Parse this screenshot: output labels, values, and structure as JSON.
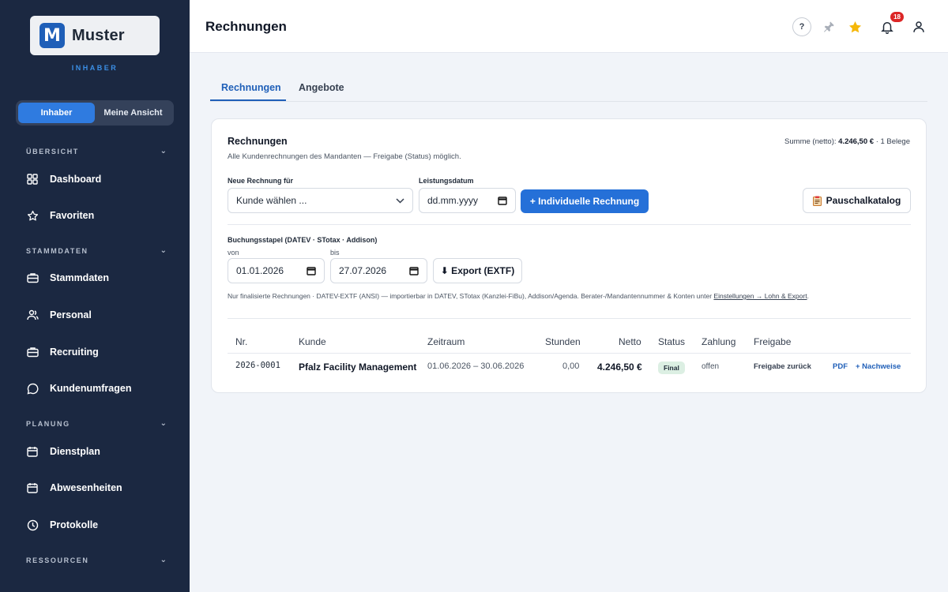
{
  "sidebar": {
    "brand": "Muster",
    "brand_mark": "M",
    "role_label": "INHABER",
    "toggle": [
      "Inhaber",
      "Meine Ansicht"
    ],
    "sections": {
      "overview": "ÜBERSICHT",
      "masterdata": "STAMMDATEN",
      "planning": "PLANUNG",
      "resources": "RESSOURCEN"
    },
    "items": {
      "dashboard": "Dashboard",
      "favorites": "Favoriten",
      "masterdata": "Stammdaten",
      "staff": "Personal",
      "recruiting": "Recruiting",
      "surveys": "Kundenumfragen",
      "roster": "Dienstplan",
      "absences": "Abwesenheiten",
      "logs": "Protokolle"
    }
  },
  "header": {
    "title": "Rechnungen",
    "help": "?",
    "notifications_count": "18"
  },
  "tabs": [
    "Rechnungen",
    "Angebote"
  ],
  "card": {
    "title": "Rechnungen",
    "subtitle": "Alle Kundenrechnungen des Mandanten — Freigabe (Status) möglich.",
    "summary_label": "Summe (netto):",
    "summary_value": "4.246,50 €",
    "summary_count": "· 1 Belege",
    "new_invoice_label": "Neue Rechnung für",
    "customer_placeholder": "Kunde wählen ...",
    "service_date_label": "Leistungsdatum",
    "service_date_placeholder": "dd.mm.yyyy",
    "individual_button": "+ Individuelle Rechnung",
    "catalog_button": "Pauschalkatalog",
    "batch_label": "Buchungsstapel (DATEV · STotax · Addison)",
    "from_label": "von",
    "to_label": "bis",
    "from_value": "01.01.2026",
    "to_value": "27.07.2026",
    "export_button": "⬇ Export (EXTF)",
    "note_text": "Nur finalisierte Rechnungen · DATEV-EXTF (ANSI) — importierbar in DATEV, STotax (Kanzlei-FiBu), Addison/Agenda. Berater-/Mandantennummer & Konten unter",
    "note_link": "Einstellungen → Lohn & Export",
    "note_end": "."
  },
  "table": {
    "columns": [
      "Nr.",
      "Kunde",
      "Zeitraum",
      "Stunden",
      "Netto",
      "Status",
      "Zahlung",
      "Freigabe"
    ],
    "rows": [
      {
        "nr": "2026-0001",
        "customer": "Pfalz Facility Management",
        "period": "01.06.2026 – 30.06.2026",
        "hours": "0,00",
        "net": "4.246,50 €",
        "status": "Final",
        "payment": "offen",
        "release": "Freigabe zurück",
        "pdf": "PDF",
        "proofs": "+ Nachweise"
      }
    ]
  },
  "colors": {
    "sidebar_bg": "#1b2841",
    "accent": "#2570d8",
    "status_final_bg": "#dcefe3",
    "badge": "#dc2626"
  }
}
